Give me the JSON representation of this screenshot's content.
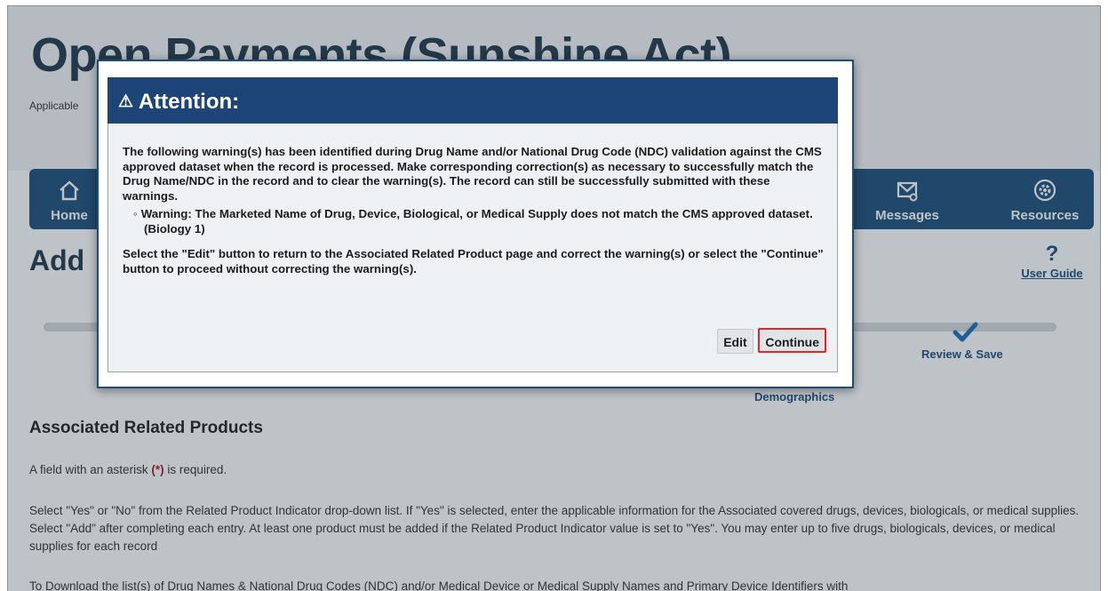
{
  "header": {
    "site_title": "Open Payments (Sunshine Act)",
    "site_subtitle": "Applicable"
  },
  "nav": {
    "home_label": "Home",
    "messages_label": "Messages",
    "resources_label": "Resources"
  },
  "page": {
    "heading": "Add",
    "user_guide_label": "User Guide",
    "user_guide_icon": "?"
  },
  "progress": {
    "review_label": "Review & Save",
    "demographics_label": "Demographics"
  },
  "content": {
    "section_heading": "Associated Related Products",
    "required_prefix": "A field with an asterisk ",
    "required_asterisk": "(*)",
    "required_suffix": " is required.",
    "instructions": "Select \"Yes\" or \"No\" from the Related Product Indicator drop-down list. If \"Yes\" is selected, enter the applicable information for the Associated covered drugs, devices, biologicals, or medical supplies. Select \"Add\" after completing each entry. At least one product must be added if the Related Product Indicator value is set to \"Yes\". You may enter up to five drugs, biologicals, devices, or medical supplies for each record",
    "download_text": "To Download the list(s) of Drug Names & National Drug Codes (NDC) and/or Medical Device or Medical Supply Names and Primary Device Identifiers with"
  },
  "modal": {
    "title_icon": "⚠",
    "title": "Attention:",
    "warning_intro": "The following warning(s) has been identified during Drug Name and/or National Drug Code (NDC) validation against the CMS approved dataset when the record is processed. Make corresponding correction(s) as necessary to successfully match the Drug Name/NDC in the record and to clear the warning(s). The record can still be successfully submitted with these warnings.",
    "warnings": [
      "Warning: The Marketed Name of Drug, Device, Biological, or Medical Supply does not match the CMS approved dataset. (Biology 1)"
    ],
    "instruction": "Select the \"Edit\" button to return to the Associated Related Product page and correct the warning(s) or select the \"Continue\" button to proceed without correcting the warning(s).",
    "edit_label": "Edit",
    "continue_label": "Continue"
  },
  "colors": {
    "nav_bg": "#1d4f7c",
    "modal_header_bg": "#1d4578",
    "highlight_border": "#e02525",
    "asterisk": "#a6192e"
  }
}
